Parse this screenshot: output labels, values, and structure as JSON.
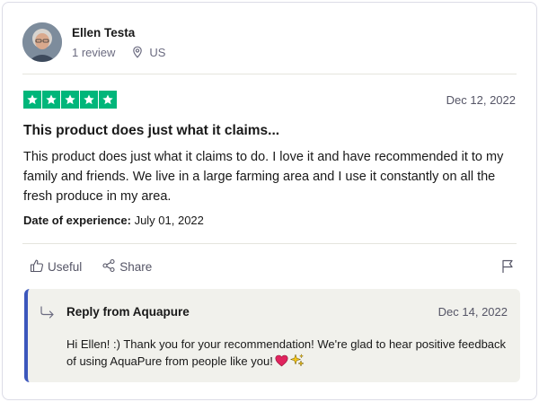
{
  "user": {
    "name": "Ellen Testa",
    "review_count": "1 review",
    "country": "US"
  },
  "review": {
    "rating": 5,
    "date": "Dec 12, 2022",
    "title": "This product does just what it claims...",
    "body": "This product does just what it claims to do. I love it and have recommended it to my family and friends. We live in a large farming area and I use it constantly on all the fresh produce in my area.",
    "experience_label": "Date of experience:",
    "experience_date": "July 01, 2022"
  },
  "actions": {
    "useful_label": "Useful",
    "share_label": "Share"
  },
  "reply": {
    "from": "Reply from Aquapure",
    "date": "Dec 14, 2022",
    "text": "Hi Ellen! :) Thank you for your recommendation! We're glad to hear positive feedback of using AquaPure from people like you!"
  },
  "colors": {
    "star_green": "#00b67a",
    "reply_accent": "#3c57bc",
    "reply_bg": "#f1f1ec"
  },
  "icons": [
    "avatar",
    "location-pin-icon",
    "star-icon",
    "thumbs-up-icon",
    "share-icon",
    "flag-icon",
    "reply-arrow-icon",
    "heart-emoji",
    "sparkles-emoji"
  ]
}
